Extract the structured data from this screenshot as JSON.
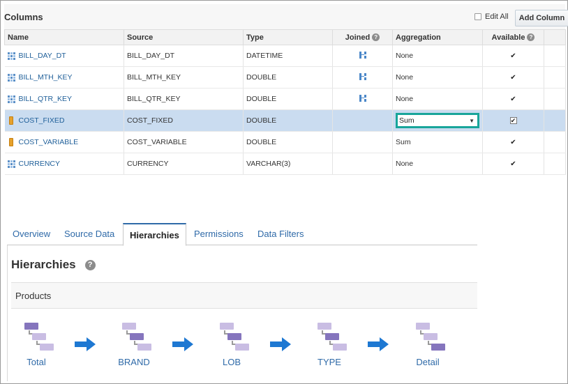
{
  "columns_panel": {
    "title": "Columns",
    "edit_all_label": "Edit All",
    "add_column_label": "Add Column",
    "headers": {
      "name": "Name",
      "source": "Source",
      "type": "Type",
      "joined": "Joined",
      "aggregation": "Aggregation",
      "available": "Available"
    },
    "rows": [
      {
        "name": "BILL_DAY_DT",
        "source": "BILL_DAY_DT",
        "type": "DATETIME",
        "aggregation": "None",
        "kind": "attribute",
        "joined": true
      },
      {
        "name": "BILL_MTH_KEY",
        "source": "BILL_MTH_KEY",
        "type": "DOUBLE",
        "aggregation": "None",
        "kind": "attribute",
        "joined": true
      },
      {
        "name": "BILL_QTR_KEY",
        "source": "BILL_QTR_KEY",
        "type": "DOUBLE",
        "aggregation": "None",
        "kind": "attribute",
        "joined": true
      },
      {
        "name": "COST_FIXED",
        "source": "COST_FIXED",
        "type": "DOUBLE",
        "aggregation": "Sum",
        "kind": "measure",
        "joined": false,
        "selected": true
      },
      {
        "name": "COST_VARIABLE",
        "source": "COST_VARIABLE",
        "type": "DOUBLE",
        "aggregation": "Sum",
        "kind": "measure",
        "joined": false
      },
      {
        "name": "CURRENCY",
        "source": "CURRENCY",
        "type": "VARCHAR(3)",
        "aggregation": "None",
        "kind": "attribute",
        "joined": false
      }
    ],
    "available_mark": "✔"
  },
  "tabs": [
    {
      "label": "Overview",
      "active": false
    },
    {
      "label": "Source Data",
      "active": false
    },
    {
      "label": "Hierarchies",
      "active": true
    },
    {
      "label": "Permissions",
      "active": false
    },
    {
      "label": "Data Filters",
      "active": false
    }
  ],
  "hierarchies": {
    "title": "Hierarchies",
    "group": "Products",
    "levels": [
      {
        "label": "Total",
        "active_box": 0
      },
      {
        "label": "BRAND",
        "active_box": 1
      },
      {
        "label": "LOB",
        "active_box": 1
      },
      {
        "label": "TYPE",
        "active_box": 1
      },
      {
        "label": "Detail",
        "active_box": 2
      }
    ]
  },
  "colors": {
    "accent_blue": "#2f6aa8",
    "selected_row": "#cadcf0",
    "focus_teal": "#18a59a",
    "arrow_blue": "#1e78d2",
    "measure_orange": "#e6a12c"
  }
}
